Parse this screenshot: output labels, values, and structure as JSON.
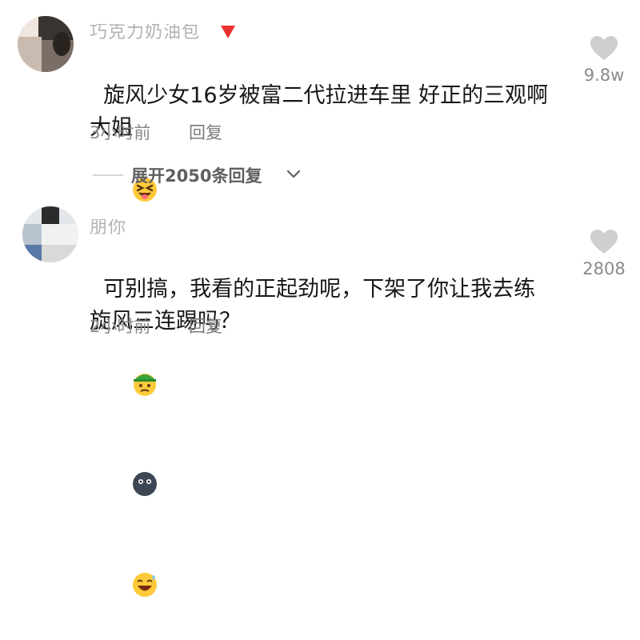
{
  "comments": [
    {
      "username": "巧克力奶油包",
      "text": "旋风少女16岁被富二代拉进车里 好正的三观啊大姐",
      "emojis": [
        "squint-tongue-emoji"
      ],
      "time": "3小时前",
      "reply_label": "回复",
      "like_count": "9.8w",
      "expand_replies_label": "展开2050条回复"
    },
    {
      "username": "朋你",
      "text": "可别搞，我看的正起劲呢，下架了你让我去练旋风三连踢吗？",
      "emojis": [
        "green-hat-emoji",
        "dark-face-emoji",
        "sweat-laugh-emoji"
      ],
      "time": "2小时前",
      "reply_label": "回复",
      "like_count": "2808"
    }
  ],
  "colors": {
    "text_primary": "#161616",
    "text_secondary": "#8a8a8a",
    "like_icon": "#cfcfcf",
    "badge_red": "#e8322e"
  }
}
